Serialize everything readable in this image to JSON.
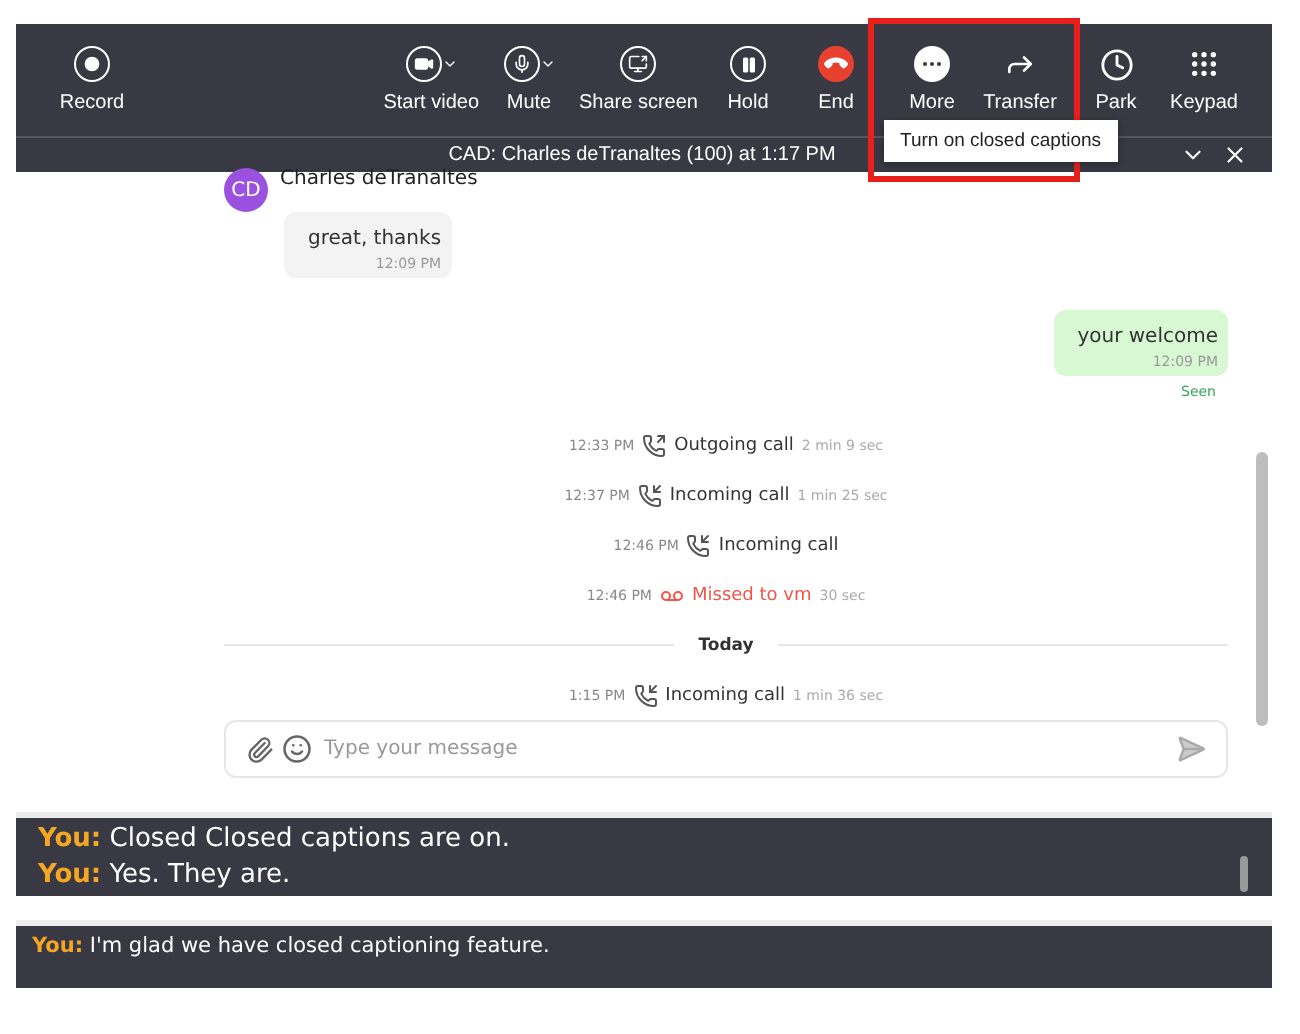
{
  "toolbar": {
    "buttons": [
      {
        "label": "Record",
        "caret": false
      },
      {
        "label": "Start video",
        "caret": true
      },
      {
        "label": "Mute",
        "caret": true
      },
      {
        "label": "Share screen",
        "caret": false
      },
      {
        "label": "Hold",
        "caret": false
      },
      {
        "label": "End",
        "caret": false
      },
      {
        "label": "More",
        "caret": false
      },
      {
        "label": "Transfer",
        "caret": false
      },
      {
        "label": "Park",
        "caret": false
      },
      {
        "label": "Keypad",
        "caret": false
      }
    ],
    "tooltip": "Turn on closed captions"
  },
  "call_bar": {
    "title": "CAD: Charles deTranaltes (100) at 1:17 PM"
  },
  "chat": {
    "items": [
      {
        "kind": "received",
        "avatar": "CD",
        "sender": "Charles deTranaltes",
        "text": "great, thanks",
        "time": "12:09 PM"
      },
      {
        "kind": "sent",
        "text": "your welcome",
        "time": "12:09 PM",
        "status": "Seen"
      },
      {
        "kind": "outgoing_call",
        "time": "12:33 PM",
        "text": "Outgoing call",
        "duration": "2 min 9 sec"
      },
      {
        "kind": "incoming_call",
        "time": "12:37 PM",
        "text": "Incoming call",
        "duration": "1 min 25 sec"
      },
      {
        "kind": "incoming_call",
        "time": "12:46 PM",
        "text": "Incoming call"
      },
      {
        "kind": "missed_call",
        "time": "12:46 PM",
        "text": "Missed to vm",
        "duration": "30 sec"
      },
      {
        "kind": "divider",
        "text": "Today"
      },
      {
        "kind": "incoming_call",
        "time": "1:15 PM",
        "text": "Incoming call",
        "duration": "1 min 36 sec"
      }
    ],
    "composer": {
      "placeholder": "Type your message"
    }
  },
  "captions": [
    {
      "lines": [
        {
          "speaker": "You:",
          "text": "Closed Closed captions are on."
        },
        {
          "speaker": "You:",
          "text": "Yes. They are."
        }
      ]
    },
    {
      "lines": [
        {
          "speaker": "You:",
          "text": "I'm glad we have closed captioning feature."
        }
      ]
    }
  ]
}
